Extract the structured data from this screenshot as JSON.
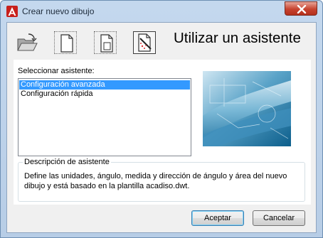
{
  "window": {
    "title": "Crear nuevo dibujo"
  },
  "toolbar": {
    "heading": "Utilizar un asistente",
    "icons": [
      "open-folder-icon",
      "blank-page-icon",
      "template-page-icon",
      "wizard-icon"
    ]
  },
  "wizard_list": {
    "label": "Seleccionar asistente:",
    "items": [
      {
        "label": "Configuración avanzada",
        "selected": true
      },
      {
        "label": "Configuración rápida",
        "selected": false
      }
    ]
  },
  "description": {
    "legend": "Descripción de asistente",
    "text": "Define las unidades, ángulo, medida y dirección de ángulo y área del nuevo dibujo y está basado en la plantilla acadiso.dwt."
  },
  "buttons": {
    "accept": "Aceptar",
    "cancel": "Cancelar"
  },
  "colors": {
    "selection": "#3399ff",
    "close_button": "#c7432f",
    "title_bar": "#c4d8ee"
  }
}
